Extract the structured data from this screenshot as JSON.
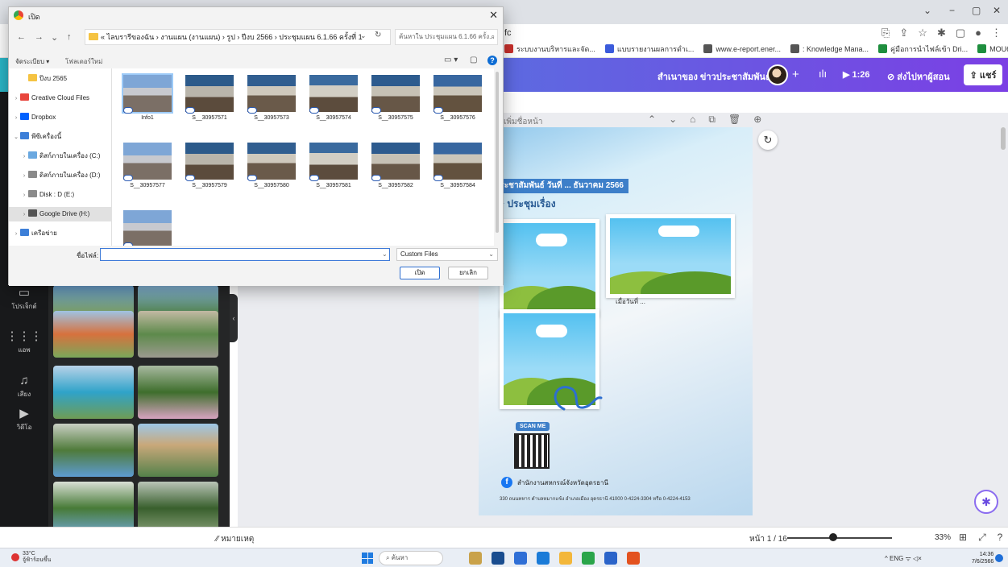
{
  "browser": {
    "address_text": "fc",
    "bookmarks": [
      {
        "label": "ระบบงานบริหารและจัด...",
        "color": "#c9302c"
      },
      {
        "label": "แบบรายงานผลการดำเ...",
        "color": "#3b5bdb"
      },
      {
        "label": "www.e-report.ener...",
        "color": "#555555"
      },
      {
        "label": ": Knowledge Mana...",
        "color": "#555555"
      },
      {
        "label": "คู่มือการนำไฟล์เข้า Dri...",
        "color": "#1e8e3e"
      },
      {
        "label": "MOU64_1 - Google...",
        "color": "#1e8e3e"
      }
    ],
    "bookmarks_more": "»"
  },
  "canva": {
    "header_title": "สำเนาของ ข่าวประชาสัมพันธ์",
    "plus": "+",
    "chart_icon": "ılı",
    "timer": "▶ 1:26",
    "send_label": "⊘ ส่งไปหาผู้สอน",
    "share_label": "⇪ แชร์",
    "rail": [
      {
        "icon": "▭",
        "label": "โปรเจ็กต์"
      },
      {
        "icon": "⋮⋮⋮",
        "label": "แอพ"
      },
      {
        "icon": "♫",
        "label": "เสียง"
      },
      {
        "icon": "▶",
        "label": "วิดีโอ"
      }
    ],
    "page_label": "เพิ่มชื่อหน้า",
    "page_tools": [
      "⌃",
      "⌄",
      "⌂",
      "⧉",
      "🗑",
      "⊕"
    ],
    "page_title_banner": "ข่าวประชาสัมพันธ์ วันที่ ... ธันวาคม 2566",
    "page_subtitle": "✦ ประชุมเรื่อง",
    "date_text": "เมื่อวันที่ ...",
    "scan_me": "SCAN ME",
    "fb_text": "สำนักงานสหกรณ์จังหวัดอุดรธานี",
    "address_text": "330 ถนนทหาร ตำบลหมากแข้ง อำเภอเมือง อุดรธานี 41000   0-4224-3304 หรือ 0-4224-4153",
    "notes_label": "⁄⁄ หมายเหตุ",
    "page_num": "หน้า 1 / 16",
    "zoom": "33%",
    "footer_icons": [
      "⊞",
      "⤢",
      "?"
    ]
  },
  "dialog": {
    "title": "เปิด",
    "close": "✕",
    "nav": {
      "back": "←",
      "forward": "→",
      "down": "⌄",
      "up": "↑"
    },
    "path": "« ไลบรารีของฉัน › งานแผน (งานแผน) › รูป › ปีงบ 2566 › ประชุมแผน 6.1.66 ครั้งที่ 1",
    "path_dropdown": "⌄",
    "refresh": "↻",
    "search_placeholder": "ค้นหาใน ประชุมแผน 6.1.66 ครั้ง...",
    "search_icon": "⌕",
    "organize": "จัดระเบียบ ▾",
    "new_folder": "โฟลเดอร์ใหม่",
    "view_icons": [
      "▭ ▾",
      "▢"
    ],
    "help": "?",
    "tree": [
      {
        "label": "ปีงบ 2565",
        "arrow": "",
        "icon_color": "#f5c342",
        "indent": 14,
        "selected": false
      },
      {
        "label": "Creative Cloud Files",
        "arrow": "›",
        "icon_color": "#e8453c",
        "indent": 4,
        "selected": false
      },
      {
        "label": "Dropbox",
        "arrow": "›",
        "icon_color": "#0061fe",
        "indent": 4,
        "selected": false
      },
      {
        "label": "พีซีเครื่องนี้",
        "arrow": "⌄",
        "icon_color": "#3d7fd8",
        "indent": 4,
        "selected": false
      },
      {
        "label": "ดิสก์ภายในเครื่อง (C:)",
        "arrow": "›",
        "icon_color": "#6aa8e0",
        "indent": 14,
        "selected": false
      },
      {
        "label": "ดิสก์ภายในเครื่อง (D:)",
        "arrow": "›",
        "icon_color": "#8a8a8a",
        "indent": 14,
        "selected": false
      },
      {
        "label": "Disk : D (E:)",
        "arrow": "›",
        "icon_color": "#8a8a8a",
        "indent": 14,
        "selected": false
      },
      {
        "label": "Google Drive (H:)",
        "arrow": "›",
        "icon_color": "#555555",
        "indent": 14,
        "selected": true
      },
      {
        "label": "เครือข่าย",
        "arrow": "›",
        "icon_color": "#3d7fd8",
        "indent": 4,
        "selected": false
      }
    ],
    "files": [
      {
        "name": "Info1",
        "selected": true
      },
      {
        "name": "S__30957571",
        "selected": false
      },
      {
        "name": "S__30957573",
        "selected": false
      },
      {
        "name": "S__30957574",
        "selected": false
      },
      {
        "name": "S__30957575",
        "selected": false
      },
      {
        "name": "S__30957576",
        "selected": false
      },
      {
        "name": "S__30957577",
        "selected": false
      },
      {
        "name": "S__30957579",
        "selected": false
      },
      {
        "name": "S__30957580",
        "selected": false
      },
      {
        "name": "S__30957581",
        "selected": false
      },
      {
        "name": "S__30957582",
        "selected": false
      },
      {
        "name": "S__30957584",
        "selected": false
      },
      {
        "name": "",
        "selected": false
      }
    ],
    "filename_label": "ชื่อไฟล์:",
    "filename_value": "",
    "filename_drop": "⌄",
    "filter": "Custom Files",
    "filter_chev": "⌄",
    "open": "เปิด",
    "cancel": "ยกเลิก"
  },
  "taskbar": {
    "temp": "33°C",
    "weather": "จู้ฟ้าร้อนขึ้น",
    "search": "ค้นหา",
    "apps": [
      "#c9a24a",
      "#1a4d8f",
      "#2f6fd6",
      "#1a7bd8",
      "#f3b73b",
      "#2aa54a",
      "#2b64c9",
      "#e3521f"
    ],
    "tray": "^  ENG  ᯤ  ◁×",
    "time": "14:36",
    "date": "7/6/2566"
  }
}
